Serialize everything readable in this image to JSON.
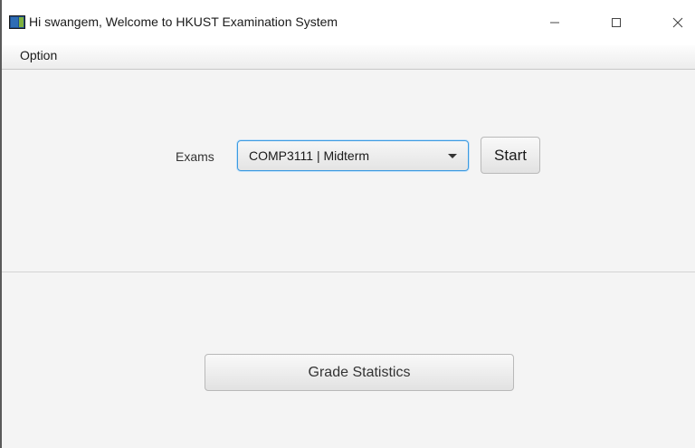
{
  "window": {
    "title": "Hi swangem, Welcome to HKUST Examination System",
    "app_icon": "java-app-icon",
    "controls": {
      "minimize_icon": "minimize-icon",
      "maximize_icon": "maximize-icon",
      "close_icon": "close-icon"
    }
  },
  "menubar": {
    "items": [
      {
        "label": "Option"
      }
    ]
  },
  "exam_selector": {
    "label": "Exams",
    "selected": "COMP3111 | Midterm",
    "start_label": "Start"
  },
  "statistics": {
    "button_label": "Grade Statistics"
  },
  "colors": {
    "focus_border": "#3c9ae0",
    "window_bg": "#f4f4f4",
    "titlebar_bg": "#ffffff"
  }
}
